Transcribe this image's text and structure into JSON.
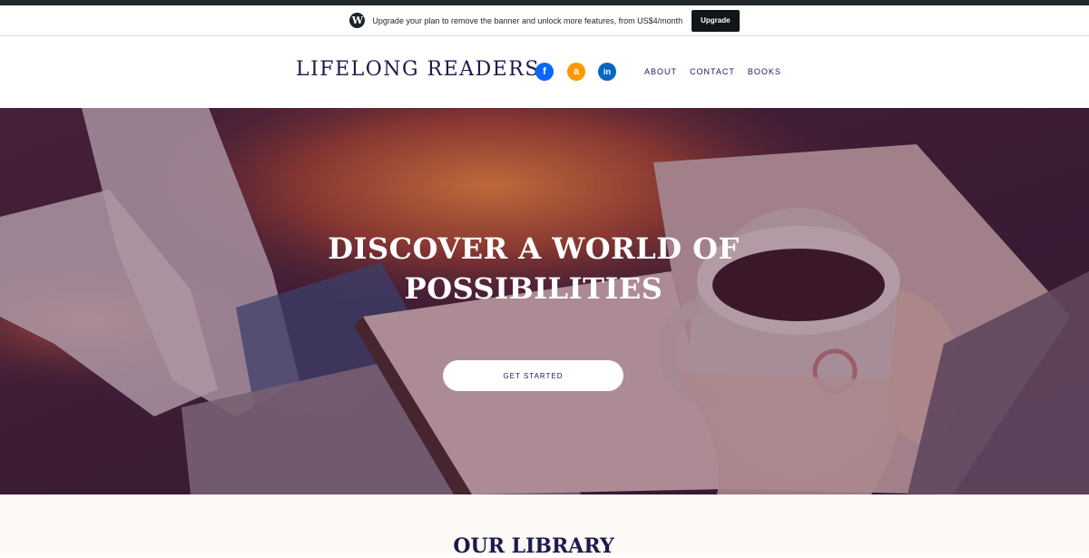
{
  "promo": {
    "text": "Upgrade your plan to remove the banner and unlock more features, from US$4/month",
    "button_label": "Upgrade",
    "logo_glyph": "W"
  },
  "header": {
    "site_title": "LIFELONG READERS",
    "social": {
      "facebook_glyph": "f",
      "amazon_glyph": "a",
      "linkedin_glyph": "in"
    },
    "nav": [
      "ABOUT",
      "CONTACT",
      "BOOKS"
    ]
  },
  "hero": {
    "title_line1": "DISCOVER A WORLD OF",
    "title_line2": "POSSIBILITIES",
    "cta_label": "GET STARTED"
  },
  "library": {
    "title": "OUR LIBRARY"
  },
  "colors": {
    "brand_navy": "#1c1a4e",
    "facebook": "#0866ff",
    "amazon": "#ff9900",
    "linkedin": "#0a66c2",
    "section_bg": "#fdf9f6"
  }
}
